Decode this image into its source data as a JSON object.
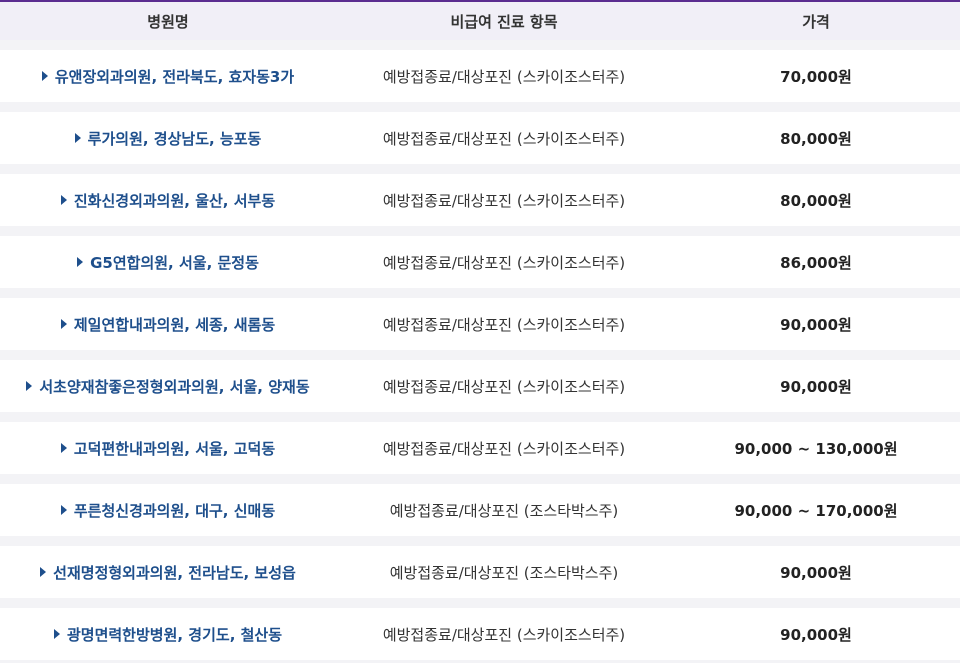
{
  "header": {
    "col_hospital": "병원명",
    "col_item": "비급여 진료 항목",
    "col_price": "가격"
  },
  "rows": [
    {
      "hospital": "유앤장외과의원, 전라북도, 효자동3가",
      "item": "예방접종료/대상포진 (스카이조스터주)",
      "price": "70,000원"
    },
    {
      "hospital": "루가의원, 경상남도, 능포동",
      "item": "예방접종료/대상포진 (스카이조스터주)",
      "price": "80,000원"
    },
    {
      "hospital": "진화신경외과의원, 울산, 서부동",
      "item": "예방접종료/대상포진 (스카이조스터주)",
      "price": "80,000원"
    },
    {
      "hospital": "G5연합의원, 서울, 문정동",
      "item": "예방접종료/대상포진 (스카이조스터주)",
      "price": "86,000원"
    },
    {
      "hospital": "제일연합내과의원, 세종, 새롬동",
      "item": "예방접종료/대상포진 (스카이조스터주)",
      "price": "90,000원"
    },
    {
      "hospital": "서초양재참좋은정형외과의원, 서울, 양재동",
      "item": "예방접종료/대상포진 (스카이조스터주)",
      "price": "90,000원"
    },
    {
      "hospital": "고덕편한내과의원, 서울, 고덕동",
      "item": "예방접종료/대상포진 (스카이조스터주)",
      "price": "90,000 ~ 130,000원"
    },
    {
      "hospital": "푸른청신경과의원, 대구, 신매동",
      "item": "예방접종료/대상포진 (조스타박스주)",
      "price": "90,000 ~ 170,000원"
    },
    {
      "hospital": "선재명정형외과의원, 전라남도, 보성읍",
      "item": "예방접종료/대상포진 (조스타박스주)",
      "price": "90,000원"
    },
    {
      "hospital": "광명면력한방병원, 경기도, 철산동",
      "item": "예방접종료/대상포진 (스카이조스터주)",
      "price": "90,000원"
    }
  ],
  "colors": {
    "accent": "#5b2d90",
    "link": "#1e4f8c"
  }
}
